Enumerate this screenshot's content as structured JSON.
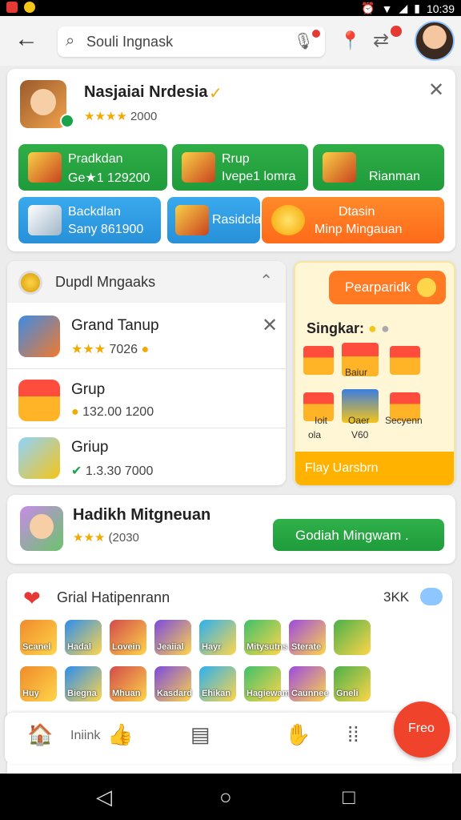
{
  "status": {
    "time": "10:39"
  },
  "search": {
    "text": "Souli Ingnask"
  },
  "card_main": {
    "title": "Nasjaiai Nrdesia",
    "rating": "2000",
    "tiles": [
      {
        "title": "Pradkdan",
        "sub": "Ge★1 129200"
      },
      {
        "title": "Rrup",
        "sub": "Ivepe1 lomra"
      },
      {
        "title": "Rianman",
        "sub": ""
      },
      {
        "title": "Backdlan",
        "sub": "Sany 861900"
      },
      {
        "title": "Rasidcla",
        "sub": ""
      },
      {
        "title": "Dtasin",
        "sub": "Minp Mingauan"
      }
    ]
  },
  "group_card": {
    "header": "Dupdl Mngaaks",
    "rows": [
      {
        "name": "Grand Tanup",
        "value": "7026"
      },
      {
        "name": "Grup",
        "value": "132.00  1200"
      },
      {
        "name": "Griup",
        "value": "1.3.30  7000"
      }
    ]
  },
  "promo_card": {
    "button": "Pearparidk",
    "label": "Singkar:",
    "gifts": [
      "Baiur",
      "Ioit",
      "Oaer",
      "Secyenn"
    ],
    "captions": [
      "ola",
      "V60"
    ],
    "footer": "Flay Uarsbrn"
  },
  "feature_card": {
    "title": "Hadikh Mitgneuan",
    "rating": "(2030",
    "button": "Godiah Mingwam ."
  },
  "list_card": {
    "title": "Grial Hatipenrann",
    "count": "3KK",
    "apps_row1": [
      "Scanel",
      "Hadal",
      "Lovein",
      "Jeaiial",
      "Hayr",
      "Mitysutns",
      "Sterate",
      ""
    ],
    "apps_row2": [
      "Huy",
      "Biegna",
      "Mhuan",
      "Kasdard",
      "Ehikan",
      "Hagiewam",
      "Caunnee",
      "Gneli"
    ]
  },
  "bottom_nav": {
    "label": "Iniink",
    "fab": "Freo"
  },
  "colors": {
    "accent_green": "#1f9b3b",
    "accent_orange": "#ff7a22",
    "fab_red": "#f0432b"
  }
}
